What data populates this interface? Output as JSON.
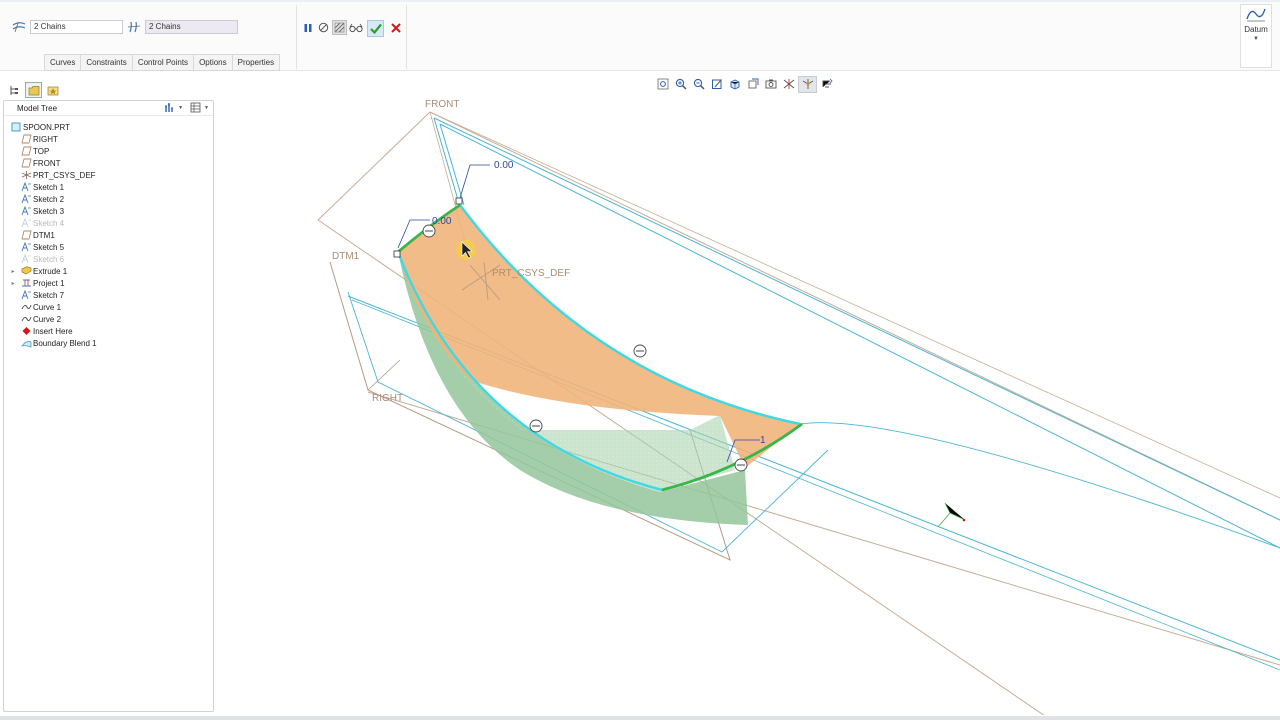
{
  "dashboard": {
    "chain1_value": "2 Chains",
    "chain2_value": "2 Chains",
    "tabs": [
      "Curves",
      "Constraints",
      "Control Points",
      "Options",
      "Properties"
    ],
    "datum_label": "Datum"
  },
  "controls": {
    "pause_icon": "pause-icon",
    "stop_icon": "stop-icon",
    "preview_icon": "preview-icon",
    "glasses_icon": "verify-icon",
    "ok_icon": "check-icon",
    "cancel_icon": "close-icon",
    "colors": {
      "ok": "#2e9e2e",
      "cancel": "#d01818"
    }
  },
  "model_tree": {
    "title": "Model Tree",
    "items": [
      {
        "label": "SPOON.PRT",
        "icon": "part-icon",
        "state": "normal"
      },
      {
        "label": "RIGHT",
        "icon": "datum-plane-icon",
        "state": "normal"
      },
      {
        "label": "TOP",
        "icon": "datum-plane-icon",
        "state": "normal"
      },
      {
        "label": "FRONT",
        "icon": "datum-plane-icon",
        "state": "normal"
      },
      {
        "label": "PRT_CSYS_DEF",
        "icon": "csys-icon",
        "state": "normal"
      },
      {
        "label": "Sketch 1",
        "icon": "sketch-icon",
        "state": "normal"
      },
      {
        "label": "Sketch 2",
        "icon": "sketch-icon",
        "state": "normal"
      },
      {
        "label": "Sketch 3",
        "icon": "sketch-icon",
        "state": "normal"
      },
      {
        "label": "Sketch 4",
        "icon": "sketch-icon",
        "state": "hidden"
      },
      {
        "label": "DTM1",
        "icon": "datum-plane-icon",
        "state": "normal"
      },
      {
        "label": "Sketch 5",
        "icon": "sketch-icon",
        "state": "normal"
      },
      {
        "label": "Sketch 6",
        "icon": "sketch-icon",
        "state": "hidden"
      },
      {
        "label": "Extrude 1",
        "icon": "extrude-icon",
        "state": "normal"
      },
      {
        "label": "Project 1",
        "icon": "project-icon",
        "state": "normal"
      },
      {
        "label": "Sketch 7",
        "icon": "sketch-icon",
        "state": "normal"
      },
      {
        "label": "Curve 1",
        "icon": "curve-icon",
        "state": "normal"
      },
      {
        "label": "Curve 2",
        "icon": "curve-icon",
        "state": "normal"
      },
      {
        "label": "Insert Here",
        "icon": "insert-here-icon",
        "state": "normal"
      },
      {
        "label": "Boundary Blend 1",
        "icon": "boundary-blend-icon",
        "state": "normal"
      }
    ]
  },
  "viewport": {
    "plane_labels": {
      "front": "FRONT",
      "right": "RIGHT",
      "dtm1": "DTM1",
      "csys": "PRT_CSYS_DEF"
    },
    "dimension_labels": [
      "0.00",
      "0.00",
      "1"
    ],
    "colors": {
      "surface_orange": "#f0b377",
      "surface_green": "#90c494",
      "edge_cyan": "#3fd9e6",
      "chain_green": "#3ab54a",
      "datum_brown": "#b59b86",
      "datum_blue": "#4ab4d6"
    }
  }
}
